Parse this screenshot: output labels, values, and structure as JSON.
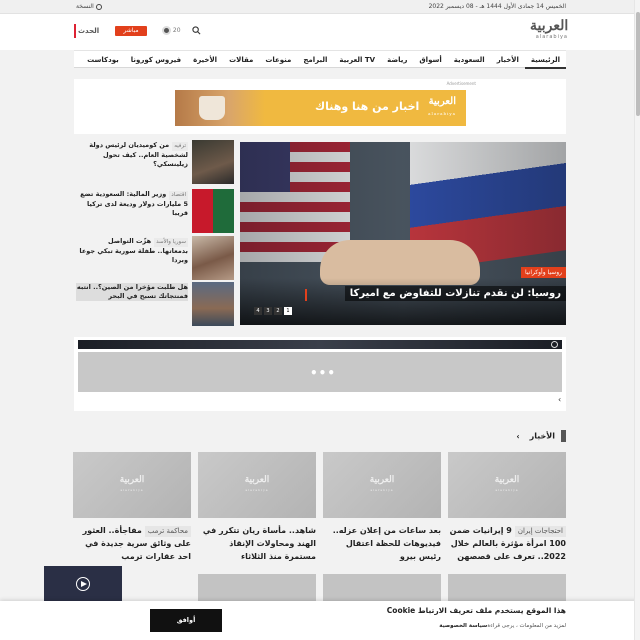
{
  "topbar": {
    "date": "الخميس 14 جمادى الأول 1444 هـ - 08 ديسمبر 2022",
    "lang": "النسخة"
  },
  "header": {
    "logo_ar": "العربية",
    "logo_en": "alarabiya",
    "weather": "20",
    "live_label": "مباشر",
    "alhadath": "الحدث"
  },
  "nav": {
    "items": [
      "الرئيسية",
      "الأخبار",
      "السعودية",
      "أسواق",
      "رياضة",
      "العربية TV",
      "البرامج",
      "منوعات",
      "مقالات",
      "الأخيرة",
      "فيروس كورونا",
      "بودكاست"
    ]
  },
  "ad": {
    "label": "Advertisement",
    "text": "اخبار من هنا وهناك",
    "logo_ar": "العربية",
    "logo_en": "alarabiya"
  },
  "hero": {
    "tag": "روسيا وأوكرانيا",
    "title": "روسيا: لن نقدم تنازلات للتفاوض مع اميركا",
    "pages": [
      "1",
      "2",
      "3",
      "4"
    ],
    "active_page": "1"
  },
  "side": [
    {
      "cat": "ترفيه",
      "title": "من كوميديان لرئيس دولة لشخصية العام.. كيف تحول زيلينسكي؟"
    },
    {
      "cat": "اقتصاد",
      "title": "وزير المالية: السعودية تضع 5 مليارات دولار وديعة لدى تركيا قريبا"
    },
    {
      "cat": "سوريا والأسد",
      "title": "هزّت التواصل بدمعاتها.. طفلة سورية تبكي جوعا وبردا"
    },
    {
      "cat": "",
      "title": "هل طلبت مؤخرا من الصين؟.. انتبه فمنتجاتك تسبح في البحر"
    }
  ],
  "widget": {
    "dots": "•••",
    "prev": "‹"
  },
  "section": {
    "title": "الأخبار",
    "chevron": "›"
  },
  "cards": [
    {
      "cat": "احتجاجات إيران",
      "title": "9 إيرانيات ضمن 100 امرأة مؤثرة بالعالم خلال 2022.. تعرف على قصصهن"
    },
    {
      "cat": "",
      "title": "بعد ساعات من إعلان عزله.. فيديوهات للحظة اعتقال رئيس بيرو"
    },
    {
      "cat": "",
      "title": "شاهد.. مأساة ريان تتكرر في الهند ومحاولات الإنقاذ مستمرة منذ الثلاثاء"
    },
    {
      "cat": "محاكمة ترمب",
      "title": "مفاجأة.. العثور على وثائق سرية جديدة في احد عقارات ترمب"
    }
  ],
  "card_logo": {
    "ar": "العربية",
    "en": "alarabiya"
  },
  "cookie": {
    "title": "هذا الموقع يستخدم ملف تعريف الارتباط Cookie",
    "sub_prefix": "لمزيد من المعلومات ، يرجى قراءة",
    "sub_link": "سياسة الخصوصية",
    "accept": "أوافق"
  }
}
